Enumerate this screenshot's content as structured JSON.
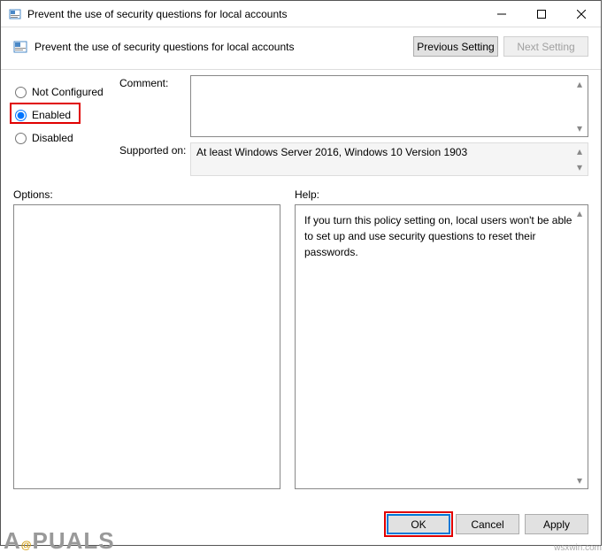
{
  "titlebar": {
    "text": "Prevent the use of security questions for local accounts"
  },
  "header": {
    "label": "Prevent the use of security questions for local accounts",
    "prev": "Previous Setting",
    "next": "Next Setting"
  },
  "radios": {
    "not_configured": "Not Configured",
    "enabled": "Enabled",
    "disabled": "Disabled"
  },
  "fields": {
    "comment_label": "Comment:",
    "supported_label": "Supported on:",
    "supported_value": "At least Windows Server 2016, Windows 10 Version 1903"
  },
  "lower": {
    "options_label": "Options:",
    "help_label": "Help:",
    "help_text": "If you turn this policy setting on, local users won't be able to set up and use security questions to reset their passwords."
  },
  "buttons": {
    "ok": "OK",
    "cancel": "Cancel",
    "apply": "Apply"
  },
  "watermark": {
    "left": "APPUALS",
    "right": "wsxwin.com"
  }
}
